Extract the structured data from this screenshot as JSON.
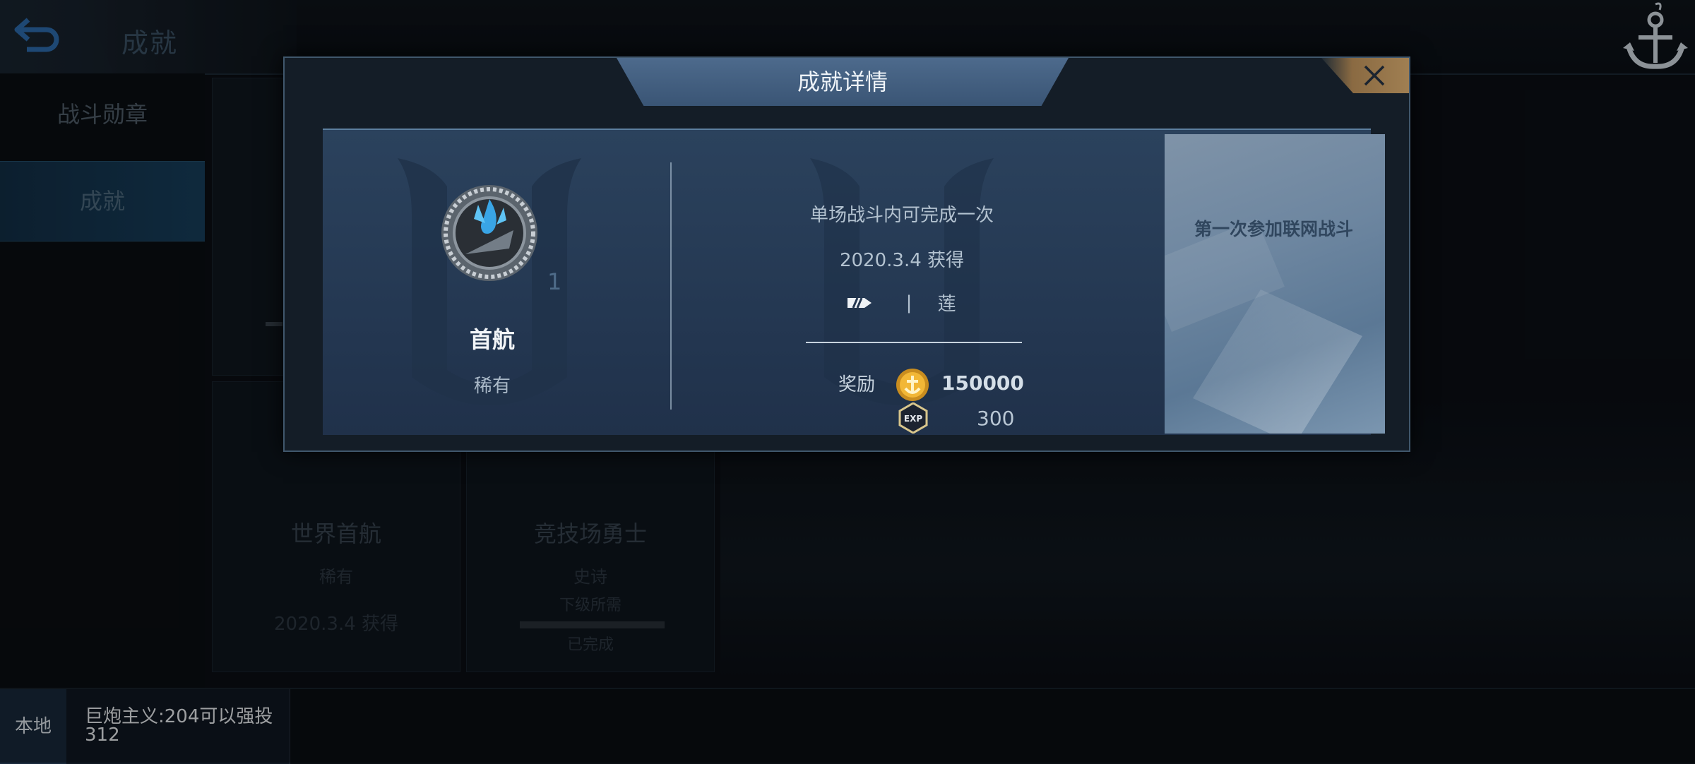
{
  "header": {
    "title": "成就",
    "back_icon": "back-arrow-icon",
    "anchor_icon": "anchor-icon"
  },
  "sidebar": {
    "items": [
      {
        "label": "战斗勋章"
      },
      {
        "label": "成就",
        "selected": true
      }
    ]
  },
  "background_cards": [
    {
      "name": "世界首航",
      "rarity": "稀有",
      "obtained": "2020.3.4 获得"
    },
    {
      "name": "竞技场勇士",
      "rarity": "史诗",
      "next_req": "下级所需",
      "status": "已完成"
    }
  ],
  "chat": {
    "channel": "本地",
    "message": "巨炮主义:204可以强投312"
  },
  "modal": {
    "title": "成就详情",
    "close_icon": "close-icon",
    "achievement": {
      "count": "1",
      "name": "首航",
      "rarity": "稀有",
      "condition": "单场战斗内可完成一次",
      "obtained": "2020.3.4  获得",
      "ship_sep": "|",
      "ship": "莲",
      "reward_label": "奖励",
      "rewards": [
        {
          "icon": "gold-coin-icon",
          "value": "150000"
        },
        {
          "icon": "exp-icon",
          "value": "300"
        }
      ],
      "description": "第一次参加联网战斗"
    }
  },
  "colors": {
    "accent": "#3a5575",
    "close_accent": "#a07f52",
    "selected_tab": "#17405e"
  }
}
